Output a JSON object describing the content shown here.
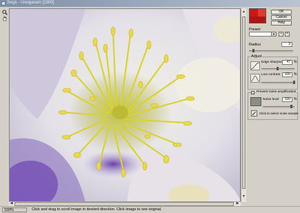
{
  "window": {
    "title": "Ssigs - Unsigasam [1300]"
  },
  "tools": [
    {
      "name": "zoom-tool",
      "icon": "magnifier-icon"
    },
    {
      "name": "hand-tool",
      "icon": "hand-icon"
    }
  ],
  "buttons": {
    "ok": "OK",
    "cancel": "Cancel",
    "help": "Help"
  },
  "preset": {
    "label": "Preset:",
    "value": ""
  },
  "radius": {
    "label": "Radius",
    "value": "3"
  },
  "adjust": {
    "title": "Adjust",
    "edge_sharpness": {
      "label": "Edge sharpness",
      "value": "47",
      "unit": "%"
    },
    "low_contrast": {
      "label": "Low contrast",
      "value": "100",
      "unit": "%"
    }
  },
  "noise": {
    "prevent_label": "Prevent noise amplification",
    "checked": true,
    "level_label": "Noise level",
    "level_value": "100",
    "unit": "%",
    "sample_hint": "Click to select noise sample"
  },
  "status": {
    "zoom": "100%",
    "message": "Click and drag to scroll image in desired direction. Click image to see original."
  }
}
